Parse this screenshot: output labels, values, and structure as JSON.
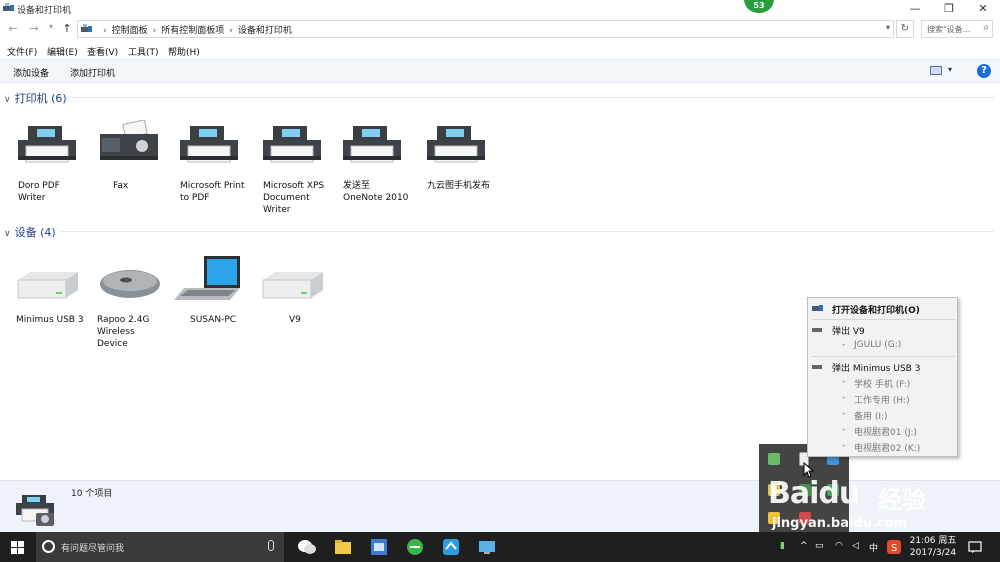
{
  "window": {
    "title": "设备和打印机",
    "minimize": "—",
    "restore": "❐",
    "close": "✕",
    "badge": "53"
  },
  "address": {
    "crumbs": [
      "控制面板",
      "所有控制面板项",
      "设备和打印机"
    ],
    "search_placeholder": "搜索\"设备...",
    "back": "←",
    "forward": "→",
    "up": "↑",
    "dropdown": "▾",
    "refresh": "↻",
    "search_icon": "⌕"
  },
  "menu": [
    "文件(F)",
    "编辑(E)",
    "查看(V)",
    "工具(T)",
    "帮助(H)"
  ],
  "commands": {
    "add_device": "添加设备",
    "add_printer": "添加打印机",
    "help": "?",
    "view_dropdown": "▾"
  },
  "printers": {
    "header": "打印机 (6)",
    "items": [
      {
        "label": "Doro PDF Writer",
        "icon": "printer-icon"
      },
      {
        "label": "Fax",
        "icon": "fax-icon"
      },
      {
        "label": "Microsoft Print to PDF",
        "icon": "printer-icon"
      },
      {
        "label": "Microsoft XPS Document Writer",
        "icon": "printer-icon"
      },
      {
        "label": "发送至 OneNote 2010",
        "icon": "printer-icon"
      },
      {
        "label": "九云图手机发布",
        "icon": "printer-icon"
      }
    ]
  },
  "devices": {
    "header": "设备 (4)",
    "items": [
      {
        "label": "Minimus USB 3",
        "icon": "drive-icon"
      },
      {
        "label": "Rapoo 2.4G Wireless Device",
        "icon": "mouse-icon"
      },
      {
        "label": "SUSAN-PC",
        "icon": "laptop-icon"
      },
      {
        "label": "V9",
        "icon": "drive-icon"
      }
    ]
  },
  "details": {
    "count": "10 个项目"
  },
  "popup": {
    "open": "打开设备和打印机(O)",
    "eject_v9": "弹出 V9",
    "v9_volumes": [
      "JGULU (G:)"
    ],
    "eject_minimus": "弹出 Minimus USB 3",
    "minimus_volumes": [
      "学校 手机 (F:)",
      "工作专用 (H:)",
      "备用 (I:)",
      "电视剧君01 (J:)",
      "电视剧君02 (K:)"
    ]
  },
  "watermark": {
    "brand": "Baidu",
    "cn": "经验",
    "url": "jingyan.baidu.com"
  },
  "taskbar": {
    "search_placeholder": "有问题尽管问我",
    "time": "21:06 周五",
    "date": "2017/3/24",
    "ime": "中",
    "chevron": "^"
  },
  "colors": {
    "accent": "#1e3f8a",
    "taskbar": "#1f1f1f",
    "help": "#1c6ed6",
    "badge": "#2a9d3c"
  }
}
